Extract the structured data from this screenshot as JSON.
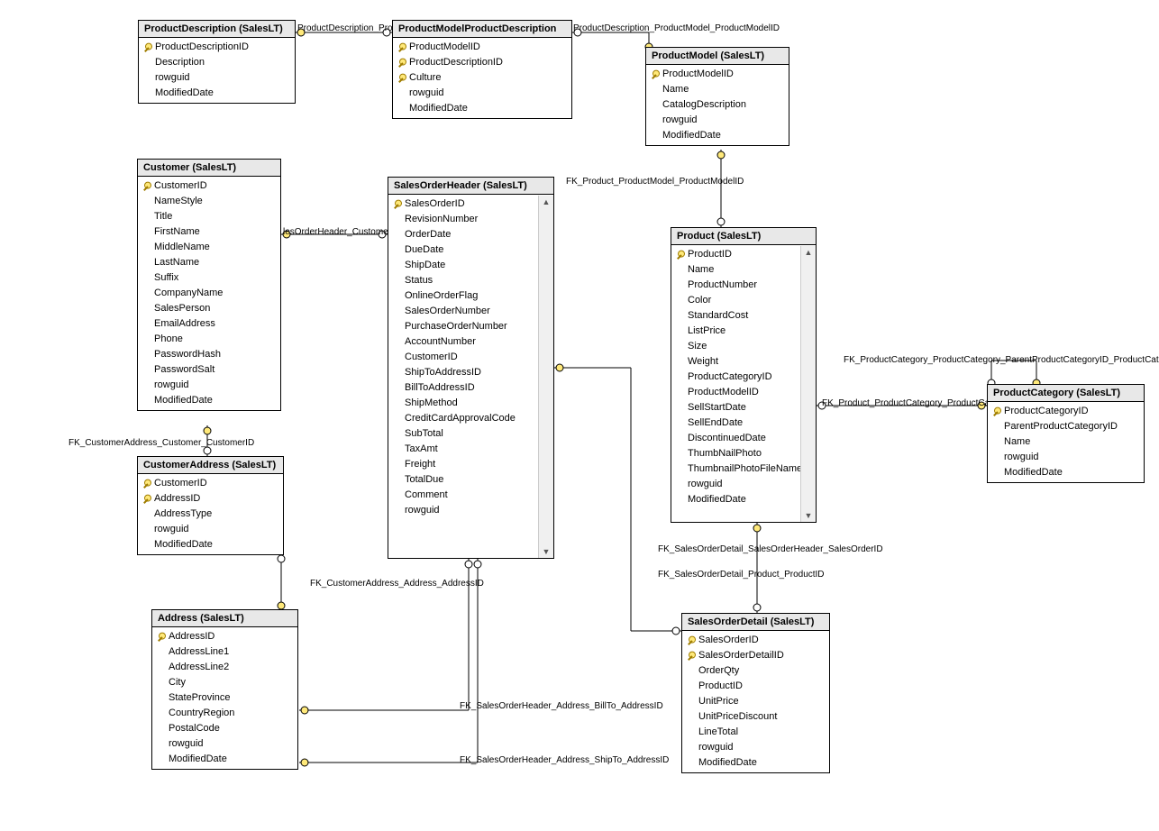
{
  "tables": {
    "ProductDescription": {
      "title": "ProductDescription (SalesLT)",
      "columns": [
        {
          "pk": true,
          "name": "ProductDescriptionID"
        },
        {
          "pk": false,
          "name": "Description"
        },
        {
          "pk": false,
          "name": "rowguid"
        },
        {
          "pk": false,
          "name": "ModifiedDate"
        }
      ]
    },
    "ProductModelProductDescription": {
      "title": "ProductModelProductDescription",
      "columns": [
        {
          "pk": true,
          "name": "ProductModelID"
        },
        {
          "pk": true,
          "name": "ProductDescriptionID"
        },
        {
          "pk": true,
          "name": "Culture"
        },
        {
          "pk": false,
          "name": "rowguid"
        },
        {
          "pk": false,
          "name": "ModifiedDate"
        }
      ]
    },
    "ProductModel": {
      "title": "ProductModel (SalesLT)",
      "columns": [
        {
          "pk": true,
          "name": "ProductModelID"
        },
        {
          "pk": false,
          "name": "Name"
        },
        {
          "pk": false,
          "name": "CatalogDescription"
        },
        {
          "pk": false,
          "name": "rowguid"
        },
        {
          "pk": false,
          "name": "ModifiedDate"
        }
      ]
    },
    "Customer": {
      "title": "Customer (SalesLT)",
      "columns": [
        {
          "pk": true,
          "name": "CustomerID"
        },
        {
          "pk": false,
          "name": "NameStyle"
        },
        {
          "pk": false,
          "name": "Title"
        },
        {
          "pk": false,
          "name": "FirstName"
        },
        {
          "pk": false,
          "name": "MiddleName"
        },
        {
          "pk": false,
          "name": "LastName"
        },
        {
          "pk": false,
          "name": "Suffix"
        },
        {
          "pk": false,
          "name": "CompanyName"
        },
        {
          "pk": false,
          "name": "SalesPerson"
        },
        {
          "pk": false,
          "name": "EmailAddress"
        },
        {
          "pk": false,
          "name": "Phone"
        },
        {
          "pk": false,
          "name": "PasswordHash"
        },
        {
          "pk": false,
          "name": "PasswordSalt"
        },
        {
          "pk": false,
          "name": "rowguid"
        },
        {
          "pk": false,
          "name": "ModifiedDate"
        }
      ]
    },
    "SalesOrderHeader": {
      "title": "SalesOrderHeader (SalesLT)",
      "columns": [
        {
          "pk": true,
          "name": "SalesOrderID"
        },
        {
          "pk": false,
          "name": "RevisionNumber"
        },
        {
          "pk": false,
          "name": "OrderDate"
        },
        {
          "pk": false,
          "name": "DueDate"
        },
        {
          "pk": false,
          "name": "ShipDate"
        },
        {
          "pk": false,
          "name": "Status"
        },
        {
          "pk": false,
          "name": "OnlineOrderFlag"
        },
        {
          "pk": false,
          "name": "SalesOrderNumber"
        },
        {
          "pk": false,
          "name": "PurchaseOrderNumber"
        },
        {
          "pk": false,
          "name": "AccountNumber"
        },
        {
          "pk": false,
          "name": "CustomerID"
        },
        {
          "pk": false,
          "name": "ShipToAddressID"
        },
        {
          "pk": false,
          "name": "BillToAddressID"
        },
        {
          "pk": false,
          "name": "ShipMethod"
        },
        {
          "pk": false,
          "name": "CreditCardApprovalCode"
        },
        {
          "pk": false,
          "name": "SubTotal"
        },
        {
          "pk": false,
          "name": "TaxAmt"
        },
        {
          "pk": false,
          "name": "Freight"
        },
        {
          "pk": false,
          "name": "TotalDue"
        },
        {
          "pk": false,
          "name": "Comment"
        },
        {
          "pk": false,
          "name": "rowguid"
        }
      ]
    },
    "Product": {
      "title": "Product (SalesLT)",
      "columns": [
        {
          "pk": true,
          "name": "ProductID"
        },
        {
          "pk": false,
          "name": "Name"
        },
        {
          "pk": false,
          "name": "ProductNumber"
        },
        {
          "pk": false,
          "name": "Color"
        },
        {
          "pk": false,
          "name": "StandardCost"
        },
        {
          "pk": false,
          "name": "ListPrice"
        },
        {
          "pk": false,
          "name": "Size"
        },
        {
          "pk": false,
          "name": "Weight"
        },
        {
          "pk": false,
          "name": "ProductCategoryID"
        },
        {
          "pk": false,
          "name": "ProductModelID"
        },
        {
          "pk": false,
          "name": "SellStartDate"
        },
        {
          "pk": false,
          "name": "SellEndDate"
        },
        {
          "pk": false,
          "name": "DiscontinuedDate"
        },
        {
          "pk": false,
          "name": "ThumbNailPhoto"
        },
        {
          "pk": false,
          "name": "ThumbnailPhotoFileName"
        },
        {
          "pk": false,
          "name": "rowguid"
        },
        {
          "pk": false,
          "name": "ModifiedDate"
        }
      ]
    },
    "ProductCategory": {
      "title": "ProductCategory (SalesLT)",
      "columns": [
        {
          "pk": true,
          "name": "ProductCategoryID"
        },
        {
          "pk": false,
          "name": "ParentProductCategoryID"
        },
        {
          "pk": false,
          "name": "Name"
        },
        {
          "pk": false,
          "name": "rowguid"
        },
        {
          "pk": false,
          "name": "ModifiedDate"
        }
      ]
    },
    "CustomerAddress": {
      "title": "CustomerAddress (SalesLT)",
      "columns": [
        {
          "pk": true,
          "name": "CustomerID"
        },
        {
          "pk": true,
          "name": "AddressID"
        },
        {
          "pk": false,
          "name": "AddressType"
        },
        {
          "pk": false,
          "name": "rowguid"
        },
        {
          "pk": false,
          "name": "ModifiedDate"
        }
      ]
    },
    "Address": {
      "title": "Address (SalesLT)",
      "columns": [
        {
          "pk": true,
          "name": "AddressID"
        },
        {
          "pk": false,
          "name": "AddressLine1"
        },
        {
          "pk": false,
          "name": "AddressLine2"
        },
        {
          "pk": false,
          "name": "City"
        },
        {
          "pk": false,
          "name": "StateProvince"
        },
        {
          "pk": false,
          "name": "CountryRegion"
        },
        {
          "pk": false,
          "name": "PostalCode"
        },
        {
          "pk": false,
          "name": "rowguid"
        },
        {
          "pk": false,
          "name": "ModifiedDate"
        }
      ]
    },
    "SalesOrderDetail": {
      "title": "SalesOrderDetail (SalesLT)",
      "columns": [
        {
          "pk": true,
          "name": "SalesOrderID"
        },
        {
          "pk": true,
          "name": "SalesOrderDetailID"
        },
        {
          "pk": false,
          "name": "OrderQty"
        },
        {
          "pk": false,
          "name": "ProductID"
        },
        {
          "pk": false,
          "name": "UnitPrice"
        },
        {
          "pk": false,
          "name": "UnitPriceDiscount"
        },
        {
          "pk": false,
          "name": "LineTotal"
        },
        {
          "pk": false,
          "name": "rowguid"
        },
        {
          "pk": false,
          "name": "ModifiedDate"
        }
      ]
    }
  },
  "relationships": {
    "r1": "ProductDescription_ProductDescription",
    "r2": "ProductDescription_ProductModel_ProductModelID",
    "r3": "FK_Product_ProductModel_ProductModelID",
    "r4": "lesOrderHeader_Customer_Custo",
    "r5": "FK_CustomerAddress_Customer_CustomerID",
    "r6": "FK_CustomerAddress_Address_AddressID",
    "r7": "FK_SalesOrderHeader_Address_BillTo_AddressID",
    "r8": "FK_SalesOrderHeader_Address_ShipTo_AddressID",
    "r9": "FK_SalesOrderDetail_SalesOrderHeader_SalesOrderID",
    "r10": "FK_SalesOrderDetail_Product_ProductID",
    "r11": "FK_Product_ProductCategory_ProductCategoryID",
    "r12": "FK_ProductCategory_ProductCategory_ParentProductCategoryID_ProductCategoryID"
  }
}
